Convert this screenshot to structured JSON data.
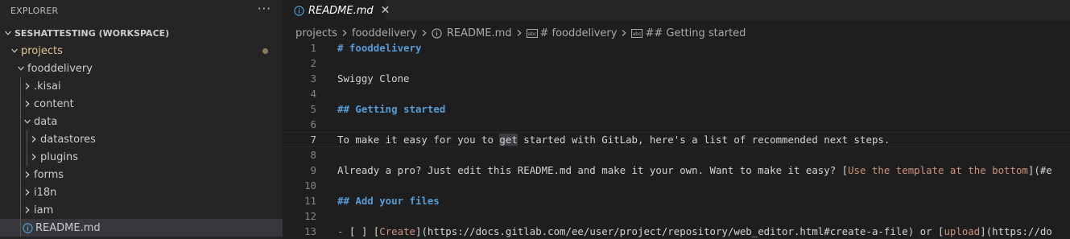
{
  "sidebar": {
    "title": "EXPLORER",
    "more": "···",
    "workspace": "SESHATTESTING (WORKSPACE)",
    "tree": [
      {
        "label": "projects",
        "depth": 0,
        "expanded": true,
        "modified": true
      },
      {
        "label": "fooddelivery",
        "depth": 1,
        "expanded": true
      },
      {
        "label": ".kisai",
        "depth": 2,
        "expanded": false
      },
      {
        "label": "content",
        "depth": 2,
        "expanded": false
      },
      {
        "label": "data",
        "depth": 2,
        "expanded": true
      },
      {
        "label": "datastores",
        "depth": 3,
        "expanded": false
      },
      {
        "label": "plugins",
        "depth": 3,
        "expanded": false
      },
      {
        "label": "forms",
        "depth": 2,
        "expanded": false
      },
      {
        "label": "i18n",
        "depth": 2,
        "expanded": false
      },
      {
        "label": "iam",
        "depth": 2,
        "expanded": false
      },
      {
        "label": "README.md",
        "depth": 2,
        "file": true,
        "selected": true
      }
    ]
  },
  "editor": {
    "tab": {
      "label": "README.md",
      "close": "✕"
    },
    "breadcrumb": {
      "projects": "projects",
      "folder": "fooddelivery",
      "file": "README.md",
      "h1": "# fooddelivery",
      "h2": "## Getting started"
    },
    "lines": [
      {
        "n": "1",
        "parts": [
          {
            "t": "# fooddelivery",
            "c": "hd"
          }
        ]
      },
      {
        "n": "2",
        "parts": []
      },
      {
        "n": "3",
        "parts": [
          {
            "t": "Swiggy Clone",
            "c": ""
          }
        ]
      },
      {
        "n": "4",
        "parts": []
      },
      {
        "n": "5",
        "parts": [
          {
            "t": "## Getting started",
            "c": "hd"
          }
        ]
      },
      {
        "n": "6",
        "parts": []
      },
      {
        "n": "7",
        "current": true,
        "parts": [
          {
            "t": "To make it easy for you to ",
            "c": ""
          },
          {
            "t": "get",
            "c": "word-hl"
          },
          {
            "t": " started with GitLab, here's a list of recommended next steps.",
            "c": ""
          }
        ]
      },
      {
        "n": "8",
        "parts": []
      },
      {
        "n": "9",
        "parts": [
          {
            "t": "Already a pro? Just edit this README.md and make it your own. Want to make it easy? ",
            "c": ""
          },
          {
            "t": "[",
            "c": "bt"
          },
          {
            "t": "Use the template at the bottom",
            "c": "lk"
          },
          {
            "t": "](#e",
            "c": "bt"
          }
        ]
      },
      {
        "n": "10",
        "parts": []
      },
      {
        "n": "11",
        "parts": [
          {
            "t": "## Add your files",
            "c": "hd"
          }
        ]
      },
      {
        "n": "12",
        "parts": []
      },
      {
        "n": "13",
        "parts": [
          {
            "t": "- ",
            "c": "lk"
          },
          {
            "t": "[ ] [",
            "c": "bt"
          },
          {
            "t": "Create",
            "c": "lk"
          },
          {
            "t": "](https://docs.gitlab.com/ee/user/project/repository/web_editor.html#create-a-file) or [",
            "c": "bt"
          },
          {
            "t": "upload",
            "c": "lk"
          },
          {
            "t": "](https://do",
            "c": "bt"
          }
        ]
      }
    ]
  }
}
